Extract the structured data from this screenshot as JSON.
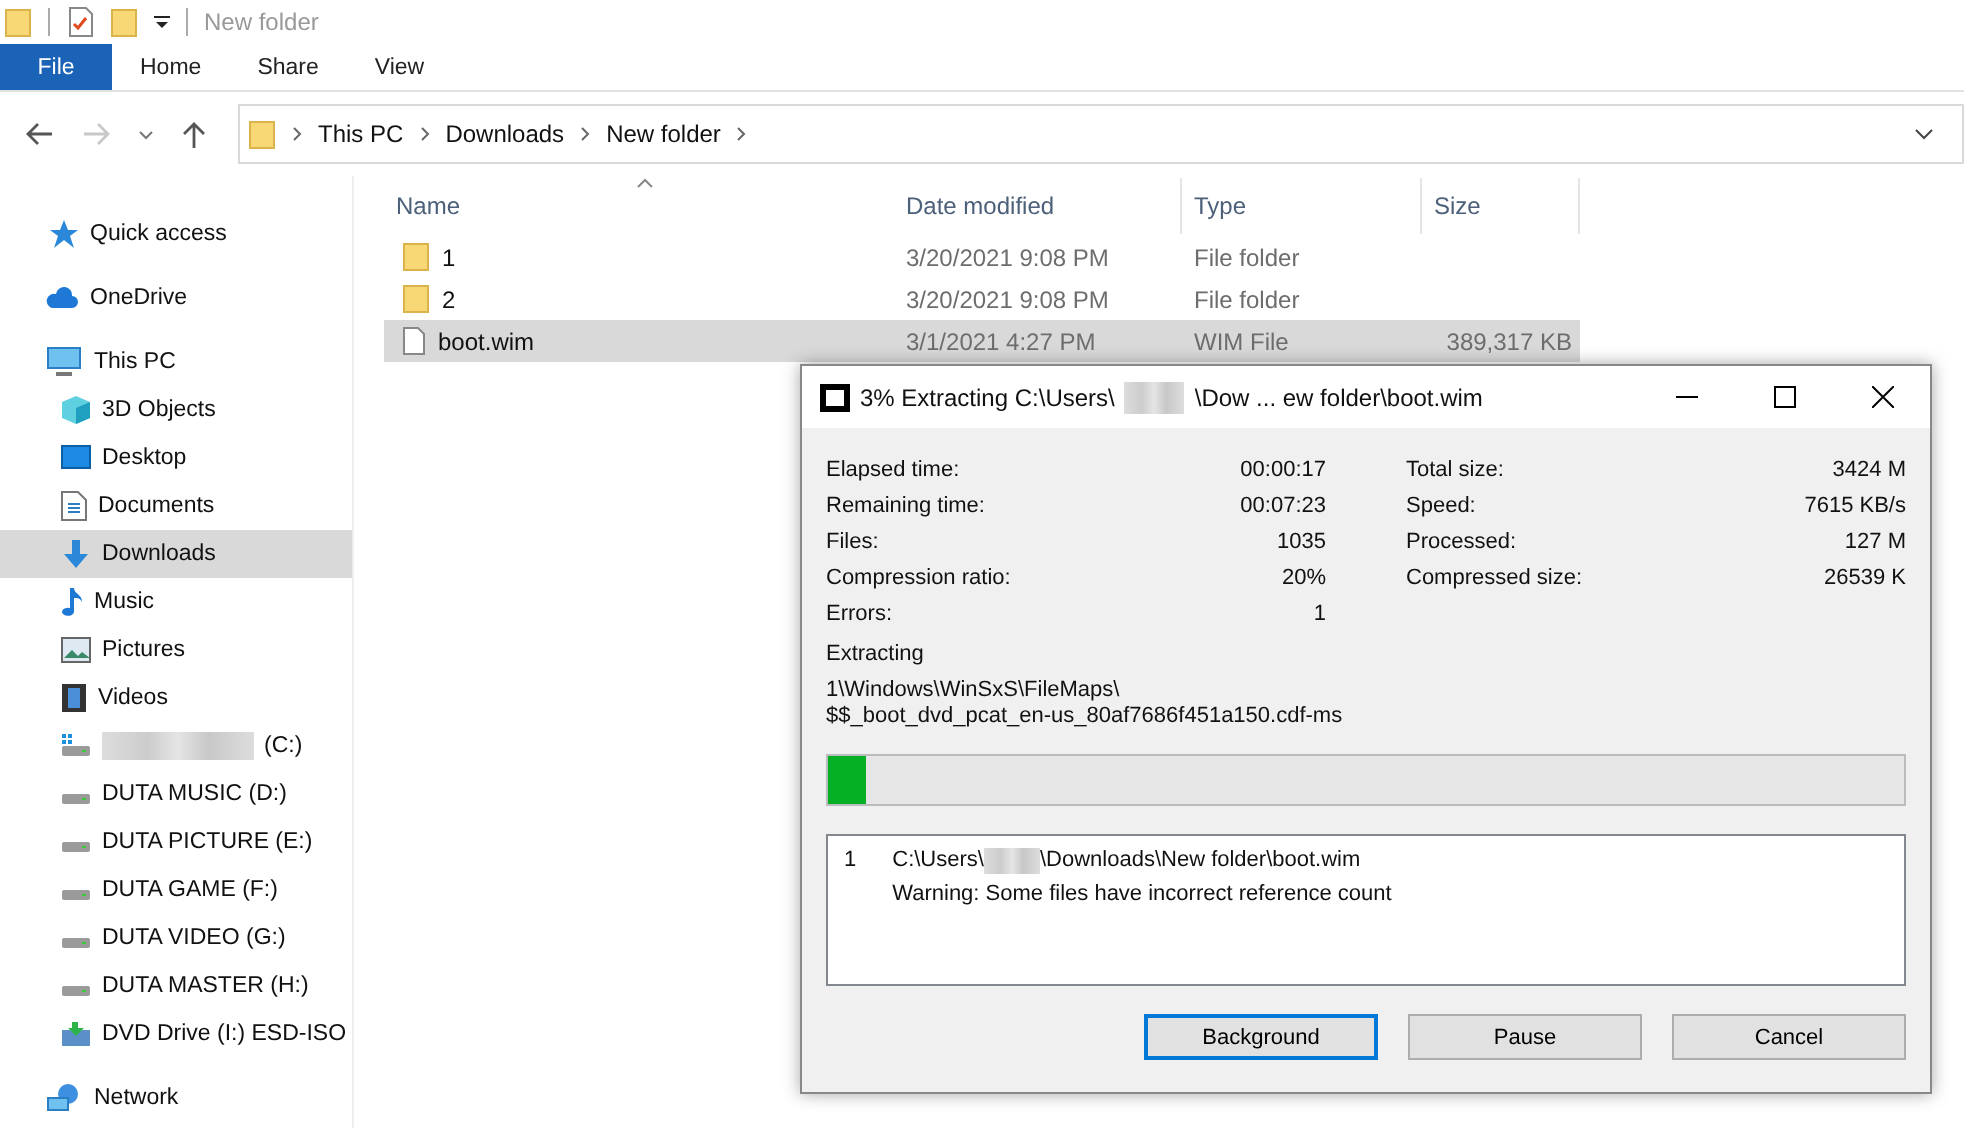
{
  "window": {
    "title": "New folder"
  },
  "ribbon_tabs": [
    {
      "label": "File",
      "selected": true
    },
    {
      "label": "Home",
      "selected": false
    },
    {
      "label": "Share",
      "selected": false
    },
    {
      "label": "View",
      "selected": false
    }
  ],
  "nav": {
    "forward_disabled": true
  },
  "breadcrumb": [
    "This PC",
    "Downloads",
    "New folder"
  ],
  "sidebar": {
    "items": [
      {
        "label": "Quick access",
        "kind": "star",
        "selected": false
      },
      {
        "label": "OneDrive",
        "kind": "cloud",
        "selected": false
      },
      {
        "label": "This PC",
        "kind": "pc",
        "selected": false,
        "children": [
          {
            "label": "3D Objects",
            "kind": "cube",
            "selected": false
          },
          {
            "label": "Desktop",
            "kind": "desktop",
            "selected": false
          },
          {
            "label": "Documents",
            "kind": "document",
            "selected": false
          },
          {
            "label": "Downloads",
            "kind": "download",
            "selected": true
          },
          {
            "label": "Music",
            "kind": "music",
            "selected": false
          },
          {
            "label": "Pictures",
            "kind": "picture",
            "selected": false
          },
          {
            "label": "Videos",
            "kind": "video",
            "selected": false
          },
          {
            "label": "(C:)",
            "kind": "system-drive",
            "redacted": true,
            "selected": false
          },
          {
            "label": "DUTA MUSIC (D:)",
            "kind": "drive",
            "selected": false
          },
          {
            "label": "DUTA PICTURE (E:)",
            "kind": "drive",
            "selected": false
          },
          {
            "label": "DUTA GAME (F:)",
            "kind": "drive",
            "selected": false
          },
          {
            "label": "DUTA VIDEO (G:)",
            "kind": "drive",
            "selected": false
          },
          {
            "label": "DUTA MASTER (H:)",
            "kind": "drive",
            "selected": false
          },
          {
            "label": "DVD Drive (I:) ESD-ISO",
            "kind": "dvd",
            "selected": false
          }
        ]
      },
      {
        "label": "Network",
        "kind": "network",
        "selected": false
      }
    ]
  },
  "table": {
    "columns": [
      "Name",
      "Date modified",
      "Type",
      "Size"
    ],
    "rows": [
      {
        "name": "1",
        "kind": "folder",
        "date": "3/20/2021 9:08 PM",
        "type": "File folder",
        "size": "",
        "selected": false
      },
      {
        "name": "2",
        "kind": "folder",
        "date": "3/20/2021 9:08 PM",
        "type": "File folder",
        "size": "",
        "selected": false
      },
      {
        "name": "boot.wim",
        "kind": "file",
        "date": "3/1/2021 4:27 PM",
        "type": "WIM File",
        "size": "389,317 KB",
        "selected": true
      }
    ]
  },
  "dialog": {
    "title_before": "3% Extracting C:\\Users\\",
    "title_after": "\\Dow ... ew folder\\boot.wim",
    "stats_left": [
      {
        "label": "Elapsed time:",
        "value": "00:00:17"
      },
      {
        "label": "Remaining time:",
        "value": "00:07:23"
      },
      {
        "label": "Files:",
        "value": "1035"
      },
      {
        "label": "Compression ratio:",
        "value": "20%"
      },
      {
        "label": "Errors:",
        "value": "1"
      }
    ],
    "stats_right": [
      {
        "label": "Total size:",
        "value": "3424 M"
      },
      {
        "label": "Speed:",
        "value": "7615 KB/s"
      },
      {
        "label": "Processed:",
        "value": "127 M"
      },
      {
        "label": "Compressed size:",
        "value": "26539 K"
      }
    ],
    "status": "Extracting",
    "current_path": "1\\Windows\\WinSxS\\FileMaps\\",
    "current_file": "$$_boot_dvd_pcat_en-us_80af7686f451a150.cdf-ms",
    "progress": {
      "level": 0.035
    },
    "log": [
      {
        "index": "1",
        "path_before": "C:\\Users\\",
        "path_after": "\\Downloads\\New folder\\boot.wim",
        "message": "Warning: Some files have incorrect reference count"
      }
    ],
    "buttons": [
      {
        "label": "Background",
        "focused": true
      },
      {
        "label": "Pause",
        "focused": false
      },
      {
        "label": "Cancel",
        "focused": false
      }
    ]
  }
}
